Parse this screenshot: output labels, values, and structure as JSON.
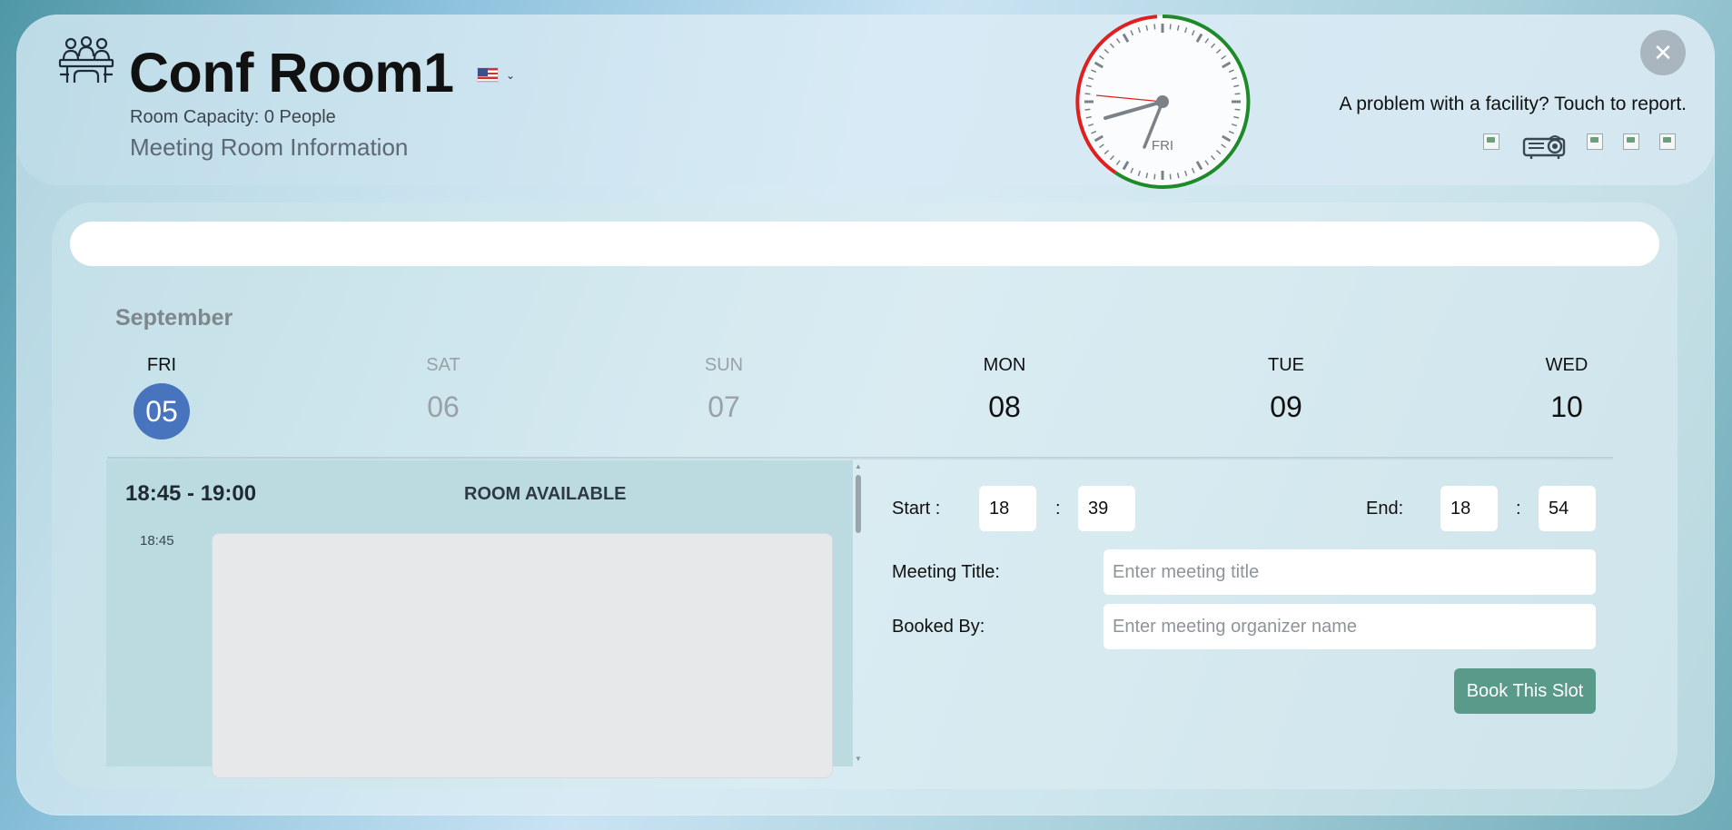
{
  "header": {
    "room_name": "Conf Room1",
    "capacity": "Room Capacity: 0 People",
    "subtitle": "Meeting Room Information",
    "language": "us-flag-icon",
    "report_text": "A problem with a facility? Touch to report.",
    "clock_day": "FRI",
    "facilities": [
      "broken-image-icon",
      "projector-icon",
      "broken-image-icon",
      "broken-image-icon",
      "broken-image-icon"
    ]
  },
  "calendar": {
    "month": "September",
    "days": [
      {
        "name": "FRI",
        "num": "05",
        "state": "selected"
      },
      {
        "name": "SAT",
        "num": "06",
        "state": "muted"
      },
      {
        "name": "SUN",
        "num": "07",
        "state": "muted"
      },
      {
        "name": "MON",
        "num": "08",
        "state": "normal"
      },
      {
        "name": "TUE",
        "num": "09",
        "state": "normal"
      },
      {
        "name": "WED",
        "num": "10",
        "state": "normal"
      }
    ]
  },
  "slot": {
    "time_range": "18:45 - 19:00",
    "status": "ROOM AVAILABLE",
    "label": "18:45"
  },
  "form": {
    "start_label": "Start :",
    "end_label": "End:",
    "colon": ":",
    "start_hour": "18",
    "start_min": "39",
    "end_hour": "18",
    "end_min": "54",
    "title_label": "Meeting Title:",
    "title_placeholder": "Enter meeting title",
    "booked_label": "Booked By:",
    "booked_placeholder": "Enter meeting organizer name",
    "book_button": "Book This Slot"
  },
  "colors": {
    "accent": "#4874bd",
    "book_button": "#5a9a8a",
    "clock_ring_green": "#2a8a2a",
    "clock_ring_red": "#e02020"
  }
}
